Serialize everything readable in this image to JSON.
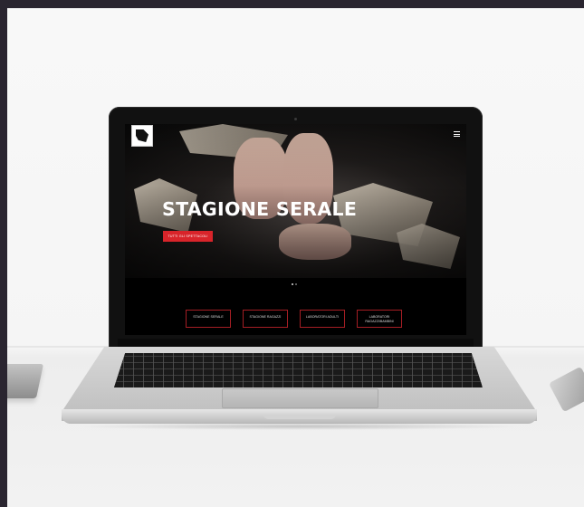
{
  "hero": {
    "title": "STAGIONE SERALE",
    "cta_label": "TUTTI GLI SPETTACOLI"
  },
  "tiles": [
    {
      "label": "STAGIONE SERALE"
    },
    {
      "label": "STAGIONE RAGAZZI"
    },
    {
      "label": "LABORATORI ADULTI"
    },
    {
      "label": "LABORATORI RAGAZZI/BAMBINI"
    }
  ],
  "slider": {
    "slides": 2,
    "active": 1
  },
  "colors": {
    "accent": "#d8242a",
    "tile_border": "#a51e24",
    "screen_bg": "#000000"
  },
  "icons": {
    "menu": "hamburger-icon",
    "logo": "theatre-logo"
  }
}
